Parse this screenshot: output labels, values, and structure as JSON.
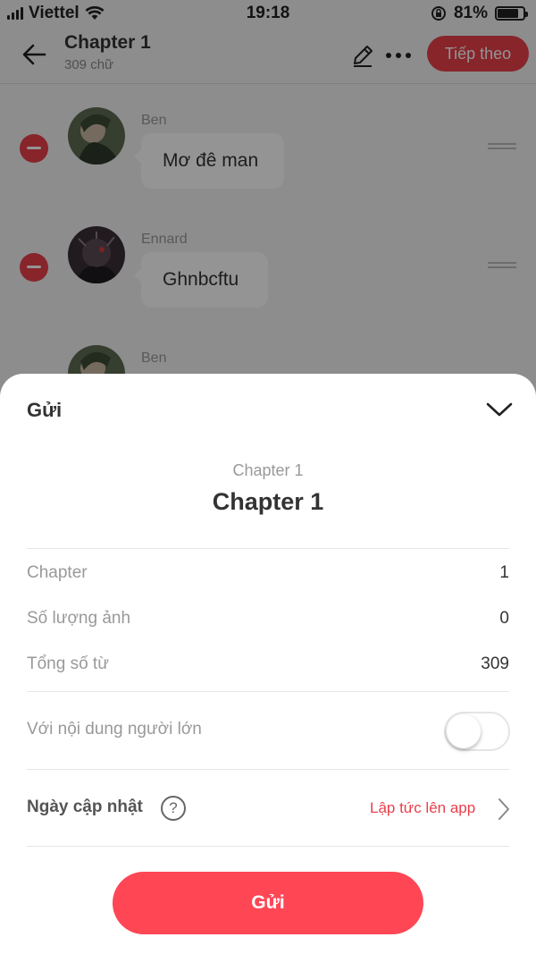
{
  "status_bar": {
    "carrier": "Viettel",
    "time": "19:18",
    "battery": "81%",
    "battery_level": 0.81
  },
  "header": {
    "title": "Chapter 1",
    "word_count": "309 chữ",
    "next_label": "Tiếp theo",
    "icons": [
      "back-arrow-icon",
      "pencil-icon",
      "more-dots-icon"
    ]
  },
  "messages": [
    {
      "speaker": "Ben",
      "text": "Mơ đê man"
    },
    {
      "speaker": "Ennard",
      "text": "Ghnbcftu"
    },
    {
      "speaker": "Ben",
      "text": ""
    }
  ],
  "sheet": {
    "title": "Gửi",
    "subtitle": "Chapter 1",
    "main_title": "Chapter 1",
    "rows": [
      {
        "label": "Chapter",
        "value": "1"
      },
      {
        "label": "Số lượng ảnh",
        "value": "0"
      },
      {
        "label": "Tổng số từ",
        "value": "309"
      }
    ],
    "adult_label": "Với nội dung người lớn",
    "adult_enabled": false,
    "date_label": "Ngày cập nhật",
    "help_symbol": "?",
    "date_value": "Lập tức lên app",
    "send_label": "Gửi"
  },
  "colors": {
    "accent": "#e8404b",
    "send_button": "#ff4655"
  }
}
